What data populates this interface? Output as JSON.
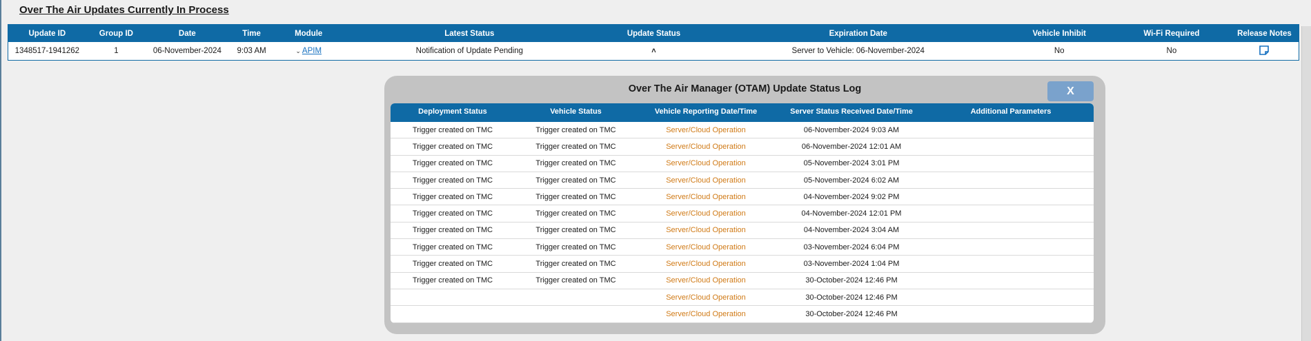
{
  "page": {
    "title": "Over The Air Updates Currently In Process"
  },
  "updates_table": {
    "headers": [
      "Update ID",
      "Group ID",
      "Date",
      "Time",
      "Module",
      "Latest Status",
      "Update Status",
      "Expiration Date",
      "Vehicle Inhibit",
      "Wi-Fi Required",
      "Release Notes"
    ],
    "row": {
      "update_id": "1348517-1941262",
      "group_id": "1",
      "date": "06-November-2024",
      "time": "9:03 AM",
      "module": "APIM",
      "latest_status": "Notification of Update Pending",
      "update_status_icon": "chevron-up-icon",
      "expiration_date": "Server to Vehicle: 06-November-2024",
      "vehicle_inhibit": "No",
      "wifi_required": "No",
      "release_notes_icon": "note-icon"
    }
  },
  "status_log": {
    "title": "Over The Air Manager (OTAM) Update Status Log",
    "close_label": "X",
    "headers": [
      "Deployment Status",
      "Vehicle Status",
      "Vehicle Reporting Date/Time",
      "Server Status Received Date/Time",
      "Additional Parameters"
    ],
    "rows": [
      {
        "deployment": "Trigger created on TMC",
        "vehicle": "Trigger created on TMC",
        "reporting": "Server/Cloud Operation",
        "received": "06-November-2024 9:03 AM",
        "params": ""
      },
      {
        "deployment": "Trigger created on TMC",
        "vehicle": "Trigger created on TMC",
        "reporting": "Server/Cloud Operation",
        "received": "06-November-2024 12:01 AM",
        "params": ""
      },
      {
        "deployment": "Trigger created on TMC",
        "vehicle": "Trigger created on TMC",
        "reporting": "Server/Cloud Operation",
        "received": "05-November-2024 3:01 PM",
        "params": ""
      },
      {
        "deployment": "Trigger created on TMC",
        "vehicle": "Trigger created on TMC",
        "reporting": "Server/Cloud Operation",
        "received": "05-November-2024 6:02 AM",
        "params": ""
      },
      {
        "deployment": "Trigger created on TMC",
        "vehicle": "Trigger created on TMC",
        "reporting": "Server/Cloud Operation",
        "received": "04-November-2024 9:02 PM",
        "params": ""
      },
      {
        "deployment": "Trigger created on TMC",
        "vehicle": "Trigger created on TMC",
        "reporting": "Server/Cloud Operation",
        "received": "04-November-2024 12:01 PM",
        "params": ""
      },
      {
        "deployment": "Trigger created on TMC",
        "vehicle": "Trigger created on TMC",
        "reporting": "Server/Cloud Operation",
        "received": "04-November-2024 3:04 AM",
        "params": ""
      },
      {
        "deployment": "Trigger created on TMC",
        "vehicle": "Trigger created on TMC",
        "reporting": "Server/Cloud Operation",
        "received": "03-November-2024 6:04 PM",
        "params": ""
      },
      {
        "deployment": "Trigger created on TMC",
        "vehicle": "Trigger created on TMC",
        "reporting": "Server/Cloud Operation",
        "received": "03-November-2024 1:04 PM",
        "params": ""
      },
      {
        "deployment": "Trigger created on TMC",
        "vehicle": "Trigger created on TMC",
        "reporting": "Server/Cloud Operation",
        "received": "30-October-2024 12:46 PM",
        "params": ""
      },
      {
        "deployment": "",
        "vehicle": "",
        "reporting": "Server/Cloud Operation",
        "received": "30-October-2024 12:46 PM",
        "params": ""
      },
      {
        "deployment": "",
        "vehicle": "",
        "reporting": "Server/Cloud Operation",
        "received": "30-October-2024 12:46 PM",
        "params": ""
      }
    ]
  },
  "colors": {
    "header_blue": "#0f6aa5",
    "link_blue": "#1570c0",
    "orange_text": "#d07a16",
    "close_button": "#7aa2cc"
  }
}
